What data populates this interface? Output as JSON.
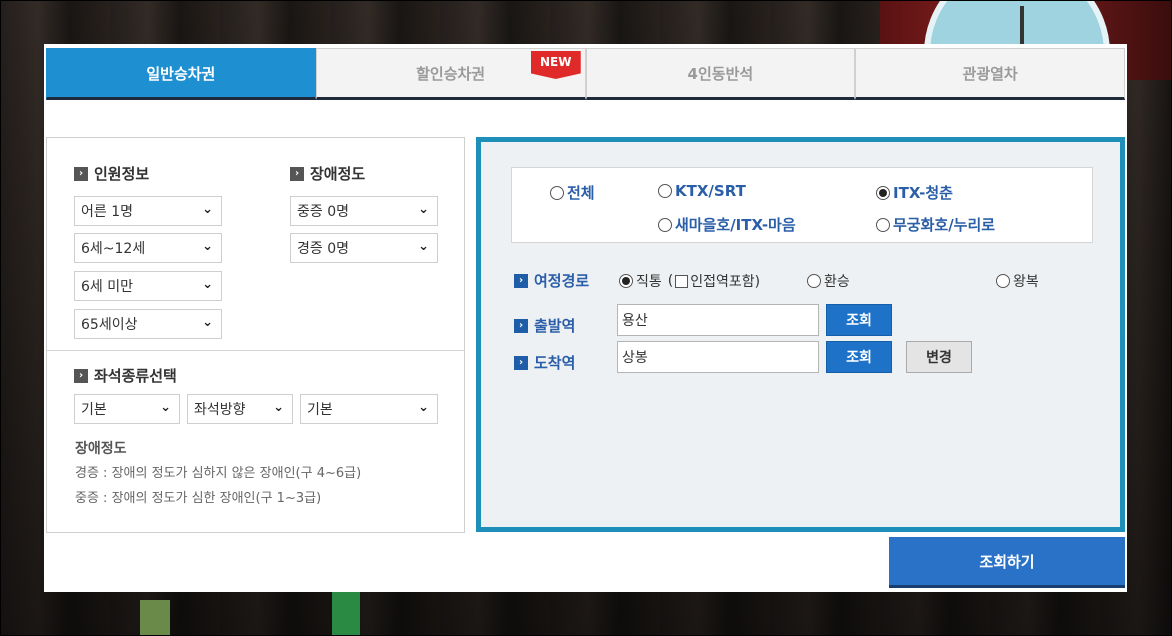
{
  "tabs": [
    {
      "label": "일반승차권",
      "active": true
    },
    {
      "label": "할인승차권",
      "active": false,
      "badge": "NEW"
    },
    {
      "label": "4인동반석",
      "active": false
    },
    {
      "label": "관광열차",
      "active": false
    }
  ],
  "passengers": {
    "title": "인원정보",
    "selects": [
      "어른 1명",
      "6세~12세",
      "6세 미만",
      "65세이상"
    ]
  },
  "disability": {
    "title": "장애정도",
    "selects": [
      "중증 0명",
      "경증 0명"
    ]
  },
  "seat": {
    "title": "좌석종류선택",
    "selects": [
      "기본",
      "좌석방향",
      "기본"
    ]
  },
  "disability_note": {
    "title": "장애정도",
    "line1": "경증 : 장애의 정도가 심하지 않은 장애인(구 4~6급)",
    "line2": "중증 : 장애의 정도가 심한 장애인(구 1~3급)"
  },
  "train_types": [
    {
      "label": "전체",
      "checked": false
    },
    {
      "label": "KTX/SRT",
      "checked": false
    },
    {
      "label": "ITX-청춘",
      "checked": true
    },
    {
      "label": "새마을호/ITX-마음",
      "checked": false
    },
    {
      "label": "무궁화호/누리로",
      "checked": false
    }
  ],
  "route": {
    "label": "여정경로",
    "direct": "직통",
    "include_prefix": "(",
    "include_transfer": "인접역포함)",
    "transfer": "환승",
    "round_trip": "왕복"
  },
  "departure": {
    "label": "출발역",
    "value": "용산",
    "button": "조회"
  },
  "arrival": {
    "label": "도착역",
    "value": "상봉",
    "button": "조회",
    "swap": "변경"
  },
  "search_button": "조회하기",
  "colors": {
    "accent": "#1e8fd0",
    "brand_blue": "#1e72c8",
    "badge_red": "#e02a2a"
  }
}
